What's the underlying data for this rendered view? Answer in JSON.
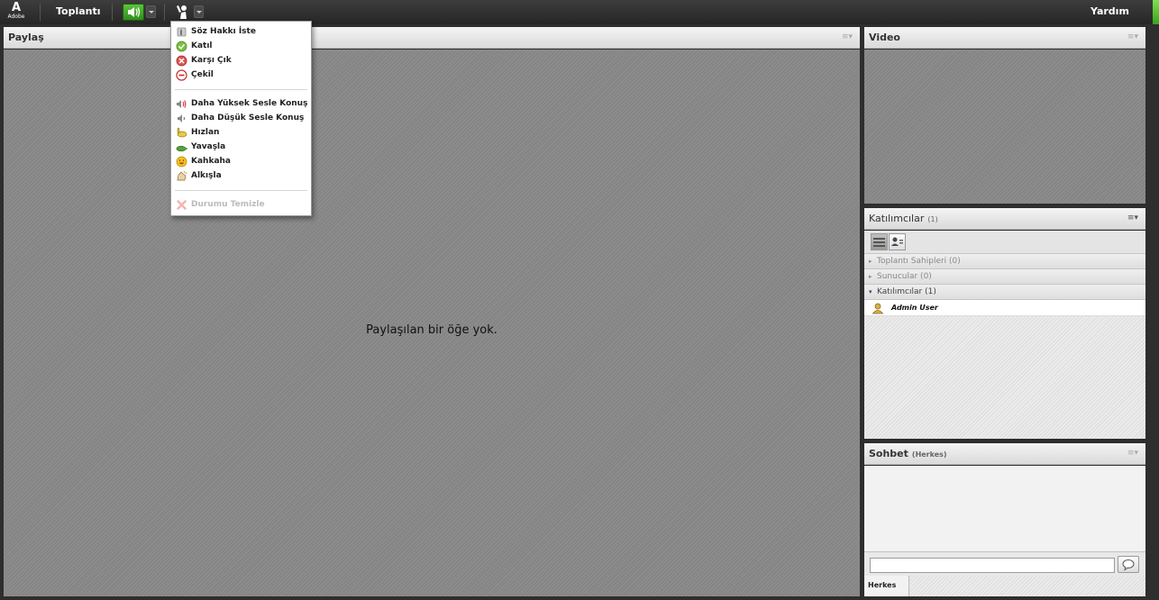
{
  "topbar": {
    "logo_letter": "A",
    "logo_text": "Adobe",
    "meeting_menu": "Toplantı",
    "help_menu": "Yardım"
  },
  "status_menu": {
    "items": [
      {
        "label": "Söz Hakkı İste",
        "icon": "raise-hand-icon"
      },
      {
        "label": "Katıl",
        "icon": "check-icon"
      },
      {
        "label": "Karşı Çık",
        "icon": "disagree-icon"
      },
      {
        "label": "Çekil",
        "icon": "step-away-icon"
      },
      {
        "label": "Daha Yüksek Sesle Konuş",
        "icon": "speaker-louder-icon"
      },
      {
        "label": "Daha Düşük Sesle Konuş",
        "icon": "speaker-softer-icon"
      },
      {
        "label": "Hızlan",
        "icon": "rabbit-icon"
      },
      {
        "label": "Yavaşla",
        "icon": "turtle-icon"
      },
      {
        "label": "Kahkaha",
        "icon": "laugh-icon"
      },
      {
        "label": "Alkışla",
        "icon": "applause-icon"
      }
    ],
    "clear": {
      "label": "Durumu Temizle",
      "icon": "clear-x-icon",
      "disabled": true
    }
  },
  "share_pod": {
    "title": "Paylaş",
    "empty_message": "Paylaşılan bir öğe yok."
  },
  "video_pod": {
    "title": "Video"
  },
  "attendees_pod": {
    "title": "Katılımcılar",
    "count": "(1)",
    "groups": [
      {
        "label": "Toplantı Sahipleri (0)",
        "expanded": false
      },
      {
        "label": "Sunucular (0)",
        "expanded": false
      },
      {
        "label": "Katılımcılar (1)",
        "expanded": true
      }
    ],
    "users": [
      {
        "name": "Admin User",
        "icon": "user-icon"
      }
    ]
  },
  "chat_pod": {
    "title": "Sohbet",
    "scope": "(Herkes)",
    "input_value": "",
    "tab_all": "Herkes"
  },
  "colors": {
    "audio_active": "#3fa82a",
    "pod_bg": "#8a8a8a"
  }
}
